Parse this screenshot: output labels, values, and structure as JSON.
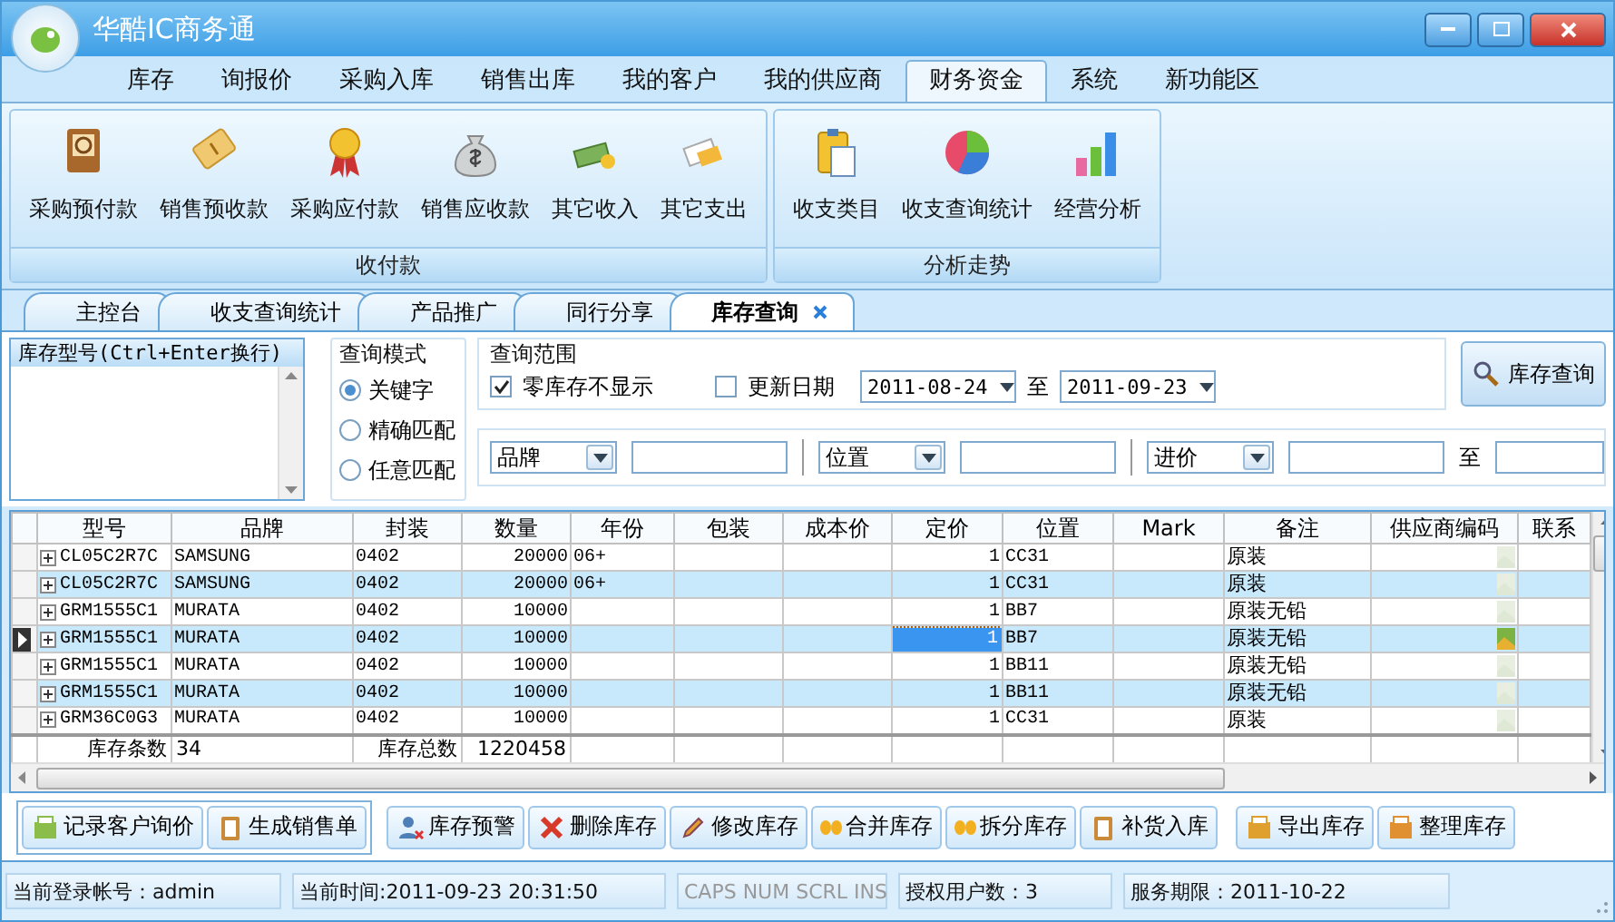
{
  "window": {
    "title": "华酷IC商务通"
  },
  "menu_tabs": [
    {
      "label": "库存",
      "selected": false
    },
    {
      "label": "询报价",
      "selected": false
    },
    {
      "label": "采购入库",
      "selected": false
    },
    {
      "label": "销售出库",
      "selected": false
    },
    {
      "label": "我的客户",
      "selected": false
    },
    {
      "label": "我的供应商",
      "selected": false
    },
    {
      "label": "财务资金",
      "selected": true
    },
    {
      "label": "系统",
      "selected": false
    },
    {
      "label": "新功能区",
      "selected": false
    }
  ],
  "ribbon_groups": [
    {
      "title": "收付款",
      "items": [
        "采购预付款",
        "销售预收款",
        "采购应付款",
        "销售应收款",
        "其它收入",
        "其它支出"
      ]
    },
    {
      "title": "分析走势",
      "items": [
        "收支类目",
        "收支查询统计",
        "经营分析"
      ]
    }
  ],
  "doc_tabs": [
    {
      "label": "主控台",
      "selected": false
    },
    {
      "label": "收支查询统计",
      "selected": false
    },
    {
      "label": "产品推广",
      "selected": false
    },
    {
      "label": "同行分享",
      "selected": false
    },
    {
      "label": "库存查询",
      "selected": true
    }
  ],
  "search": {
    "model_label": "库存型号(Ctrl+Enter换行)",
    "mode": {
      "title": "查询模式",
      "options": [
        {
          "label": "关键字",
          "selected": true
        },
        {
          "label": "精确匹配",
          "selected": false
        },
        {
          "label": "任意匹配",
          "selected": false
        }
      ]
    },
    "range": {
      "title": "查询范围",
      "hide_zero": {
        "label": "零库存不显示",
        "checked": true
      },
      "update_date": {
        "label": "更新日期",
        "checked": false
      },
      "date_from": "2011-08-24",
      "to_label": "至",
      "date_to": "2011-09-23"
    },
    "query_button": "库存查询",
    "filters": [
      {
        "field": "品牌"
      },
      {
        "field": "位置"
      },
      {
        "field": "进价",
        "to_label": "至"
      }
    ]
  },
  "grid": {
    "columns": [
      "型号",
      "品牌",
      "封装",
      "数量",
      "年份",
      "包装",
      "成本价",
      "定价",
      "位置",
      "Mark",
      "备注",
      "供应商编码",
      "联系"
    ],
    "rows": [
      {
        "model": "CL05C2R7C",
        "brand": "SAMSUNG",
        "package": "0402",
        "qty": "20000",
        "year": "06+",
        "price": "1",
        "location": "CC31",
        "note": "原装",
        "current": false
      },
      {
        "model": "CL05C2R7C",
        "brand": "SAMSUNG",
        "package": "0402",
        "qty": "20000",
        "year": "06+",
        "price": "1",
        "location": "CC31",
        "note": "原装",
        "current": false
      },
      {
        "model": "GRM1555C1",
        "brand": "MURATA",
        "package": "0402",
        "qty": "10000",
        "price": "1",
        "location": "BB7",
        "note": "原装无铅",
        "current": false
      },
      {
        "model": "GRM1555C1",
        "brand": "MURATA",
        "package": "0402",
        "qty": "10000",
        "price": "1",
        "location": "BB7",
        "note": "原装无铅",
        "current": true
      },
      {
        "model": "GRM1555C1",
        "brand": "MURATA",
        "package": "0402",
        "qty": "10000",
        "price": "1",
        "location": "BB11",
        "note": "原装无铅",
        "current": false
      },
      {
        "model": "GRM1555C1",
        "brand": "MURATA",
        "package": "0402",
        "qty": "10000",
        "price": "1",
        "location": "BB11",
        "note": "原装无铅",
        "current": false
      },
      {
        "model": "GRM36C0G3",
        "brand": "MURATA",
        "package": "0402",
        "qty": "10000",
        "price": "1",
        "location": "CC31",
        "note": "原装",
        "current": false
      }
    ],
    "footer": {
      "count_label": "库存条数",
      "count": "34",
      "total_label": "库存总数",
      "total": "1220458"
    }
  },
  "action_groups": [
    {
      "framed": true,
      "buttons": [
        "记录客户询价",
        "生成销售单"
      ]
    },
    {
      "framed": false,
      "buttons": [
        "库存预警",
        "删除库存",
        "修改库存",
        "合并库存",
        "拆分库存",
        "补货入库"
      ]
    },
    {
      "framed": false,
      "buttons": [
        "导出库存",
        "整理库存"
      ]
    }
  ],
  "status_bar": [
    {
      "text": "当前登录帐号：admin",
      "disabled": false
    },
    {
      "text": "当前时间:2011-09-23 20:31:50",
      "disabled": false
    },
    {
      "text": "CAPS NUM SCRL INS",
      "disabled": true
    },
    {
      "text": "授权用户数：3",
      "disabled": false
    },
    {
      "text": "服务期限：2011-10-22",
      "disabled": false
    }
  ]
}
